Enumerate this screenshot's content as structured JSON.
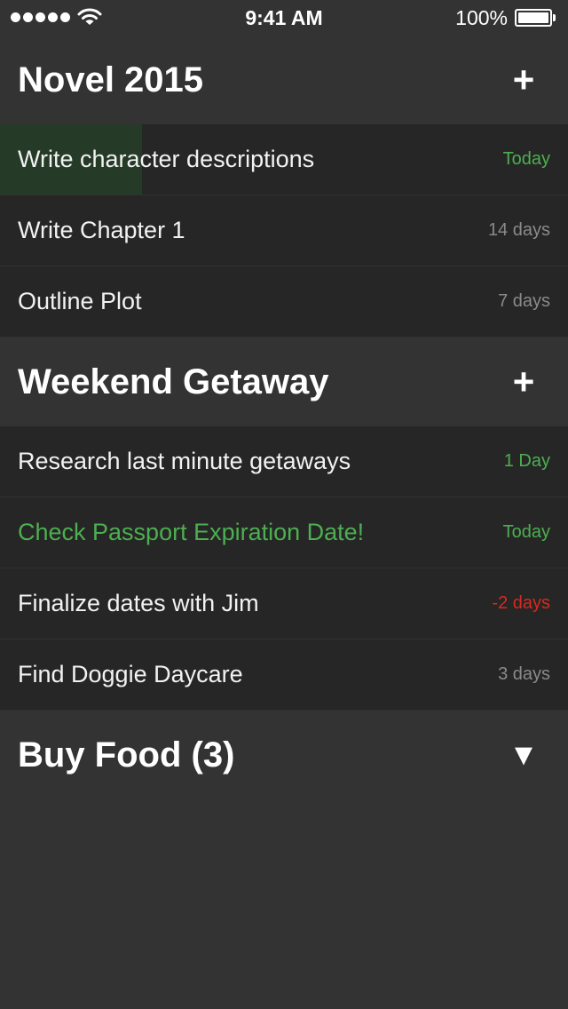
{
  "status_bar": {
    "time": "9:41 AM",
    "battery_percent": "100%",
    "signal_bars": 5,
    "wifi_icon": "wifi-icon",
    "battery_icon": "battery-icon"
  },
  "colors": {
    "background": "#333333",
    "row_background": "#262626",
    "accent_green": "#4caf50",
    "overdue_red": "#d52a1f",
    "muted": "#8a8a8a",
    "swipe_highlight": "#253a27"
  },
  "sections": [
    {
      "title": "Novel 2015",
      "action": "+",
      "action_icon": "plus-icon",
      "tasks": [
        {
          "label": "Write character descriptions",
          "due": "Today",
          "due_style": "green",
          "label_style": "normal"
        },
        {
          "label": "Write Chapter 1",
          "due": "14 days",
          "due_style": "muted",
          "label_style": "normal"
        },
        {
          "label": "Outline Plot",
          "due": "7 days",
          "due_style": "muted",
          "label_style": "normal"
        }
      ]
    },
    {
      "title": "Weekend Getaway",
      "action": "+",
      "action_icon": "plus-icon",
      "tasks": [
        {
          "label": "Research last minute getaways",
          "due": "1 Day",
          "due_style": "green",
          "label_style": "normal"
        },
        {
          "label": "Check Passport Expiration Date!",
          "due": "Today",
          "due_style": "green",
          "label_style": "alert"
        },
        {
          "label": "Finalize dates with Jim",
          "due": "-2 days",
          "due_style": "red",
          "label_style": "normal"
        },
        {
          "label": "Find Doggie Daycare",
          "due": "3 days",
          "due_style": "muted",
          "label_style": "normal"
        }
      ]
    },
    {
      "title": "Buy Food (3)",
      "action": "▼",
      "action_icon": "expand-triangle-icon",
      "tasks": []
    }
  ]
}
